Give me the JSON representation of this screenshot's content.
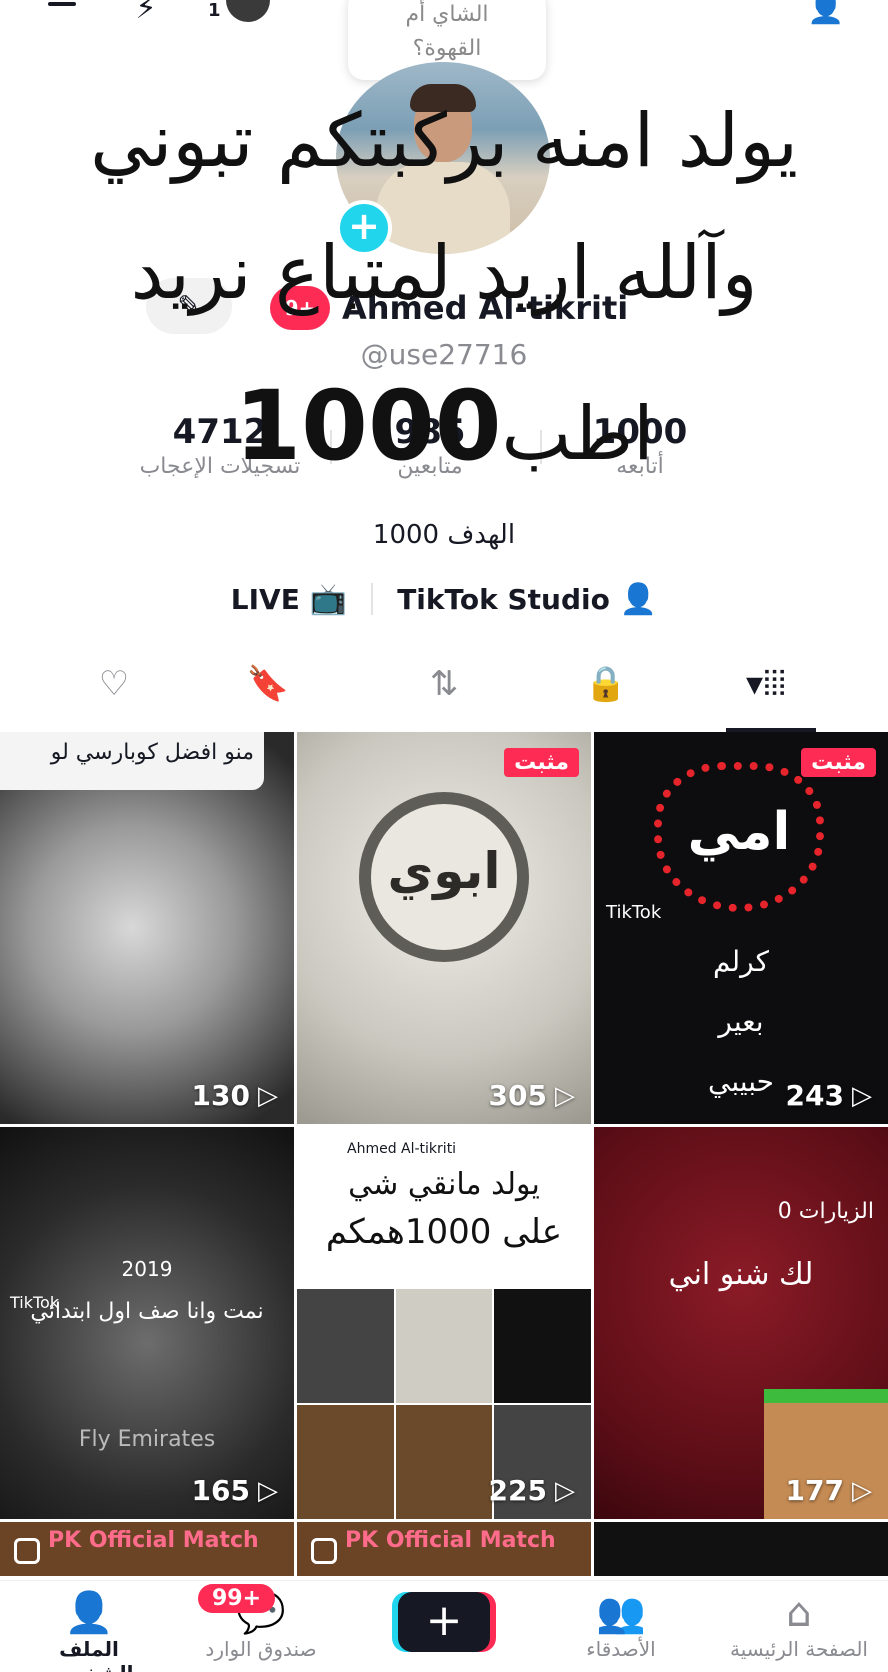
{
  "topbar": {
    "icons": [
      "menu-icon",
      "spark-icon",
      "add-user-icon"
    ],
    "badge": "1"
  },
  "note": {
    "text_line1": "الشاي أم",
    "text_line2": "القهوة؟"
  },
  "profile": {
    "name_badge": "9+",
    "display_name": "Ahmed Al-tikriti",
    "username": "@use27716",
    "edit_icon": "pencil-icon",
    "stats": {
      "likes_count": "4712",
      "likes_label": "تسجيلات الإعجاب",
      "followers_count": "985",
      "followers_label": "متابعين",
      "following_count": "1000",
      "following_label": "أتابعه"
    },
    "bio": "الهدف 1000"
  },
  "overlay_text": {
    "line1": "يولد امنه بركبتكم تبوني",
    "line2": "وآلله اريد لمتباع نريد",
    "line3_word": "اطب",
    "line3_number": "1000"
  },
  "chips": {
    "live": "LIVE",
    "studio": "TikTok Studio"
  },
  "tabs": [
    "grid-icon",
    "lock-icon",
    "repost-icon",
    "favorites-icon",
    "liked-icon"
  ],
  "videos": [
    {
      "views": "130",
      "caption": "منو افضل كوبارسي لو"
    },
    {
      "views": "305",
      "pinned": "مثبت",
      "word": "ابوي"
    },
    {
      "views": "243",
      "pinned": "مثبت",
      "word": "امي",
      "mark": "TikTok",
      "lines": [
        "كرلم",
        "بعير",
        "حبيبي"
      ]
    },
    {
      "views": "165",
      "year": "2019",
      "line": "نمت وانا صف اول ابتدائي",
      "mark": "TikTok",
      "shirt": "Fly Emirates"
    },
    {
      "views": "225",
      "header": "Ahmed Al-tikriti",
      "line1": "يولد مانقي شي",
      "line2": "على 1000همكم"
    },
    {
      "views": "177",
      "visits": "0 الزيارات",
      "say": "لك شنو اني"
    },
    {
      "pk": "PK Official Match"
    },
    {
      "pk": "PK Official Match"
    },
    {}
  ],
  "bottom_nav": {
    "profile": "الملف الشخصي",
    "inbox": "صندوق الوارد",
    "inbox_badge": "99+",
    "friends": "الأصدقاء",
    "home": "الصفحة الرئيسية",
    "create": "+"
  },
  "colors": {
    "accent": "#fe2c55",
    "cyan": "#20d5ec"
  }
}
